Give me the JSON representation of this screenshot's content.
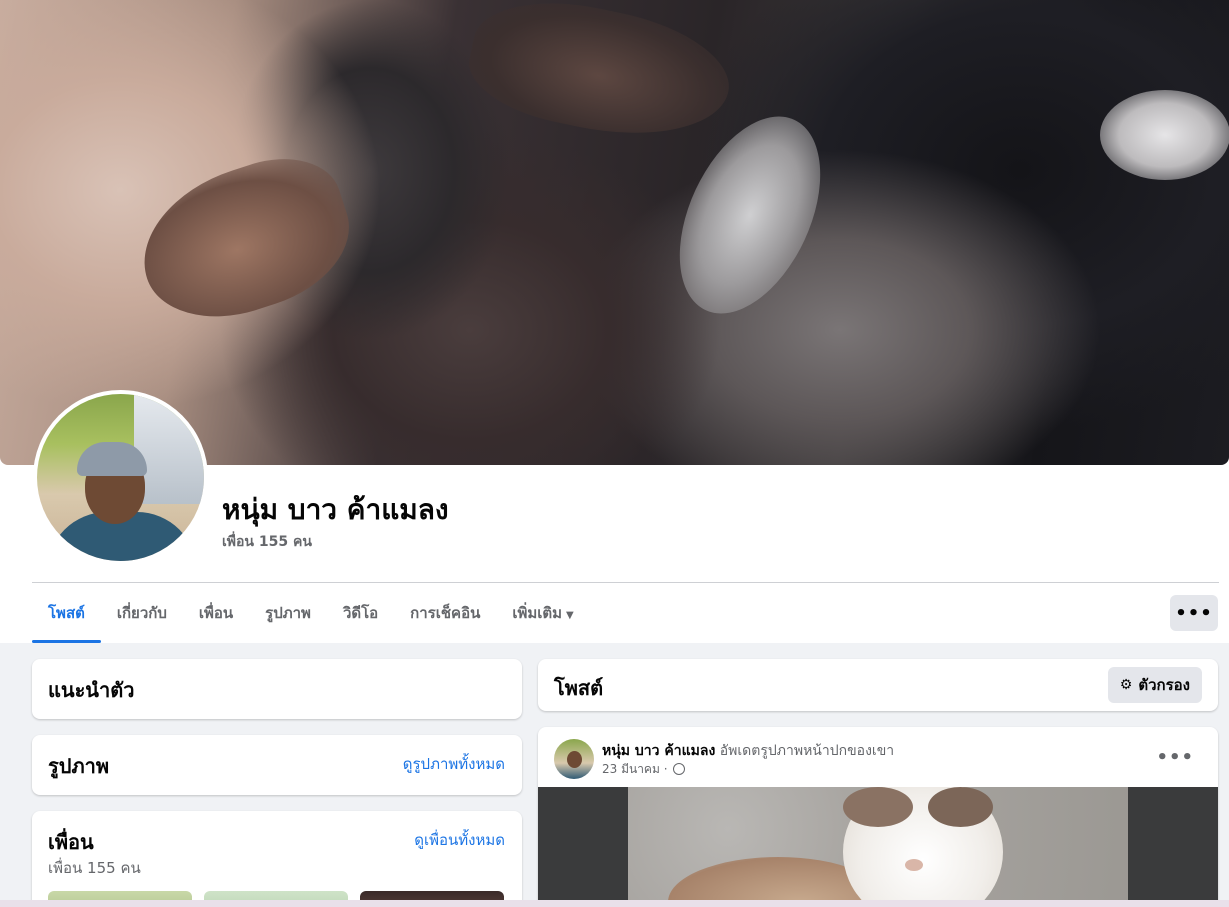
{
  "profile": {
    "name": "หนุ่ม บาว ค้าแมลง",
    "friends_count": "เพื่อน 155 คน"
  },
  "tabs": [
    {
      "label": "โพสต์",
      "active": true
    },
    {
      "label": "เกี่ยวกับ"
    },
    {
      "label": "เพื่อน"
    },
    {
      "label": "รูปภาพ"
    },
    {
      "label": "วิดีโอ"
    },
    {
      "label": "การเช็คอิน"
    },
    {
      "label": "เพิ่มเติม"
    }
  ],
  "more_menu_icon": "ellipsis-icon",
  "intro": {
    "title": "แนะนำตัว"
  },
  "photos": {
    "title": "รูปภาพ",
    "see_all": "ดูรูปภาพทั้งหมด"
  },
  "friends": {
    "title": "เพื่อน",
    "see_all": "ดูเพื่อนทั้งหมด",
    "count": "เพื่อน 155 คน"
  },
  "posts": {
    "title": "โพสต์",
    "filter_label": "ตัวกรอง"
  },
  "post": {
    "author": "หนุ่ม บาว ค้าแมลง",
    "action": "อัพเดตรูปภาพหน้าปกของเขา",
    "date": "23 มีนาคม",
    "separator": "·",
    "privacy_icon": "globe-icon"
  },
  "colors": {
    "accent": "#1b74e4",
    "background": "#f0f2f5",
    "secondary_text": "#65676b"
  }
}
